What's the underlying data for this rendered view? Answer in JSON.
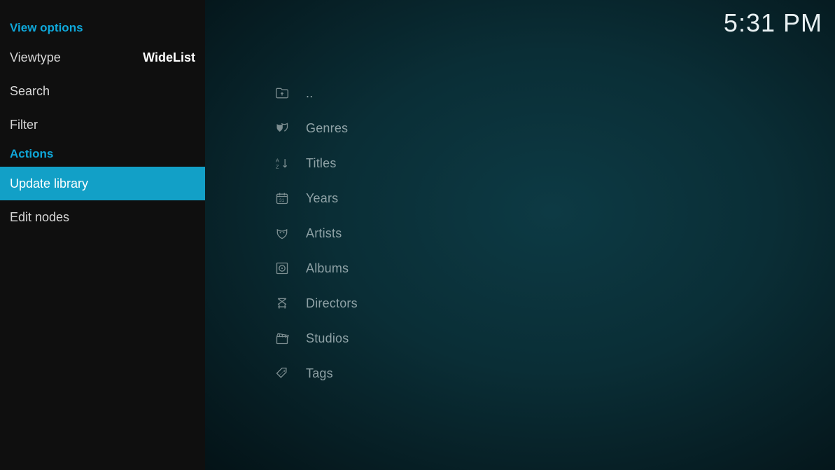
{
  "clock": "5:31 PM",
  "panel": {
    "view_options_heading": "View options",
    "viewtype_label": "Viewtype",
    "viewtype_value": "WideList",
    "search_label": "Search",
    "filter_label": "Filter",
    "actions_heading": "Actions",
    "update_library_label": "Update library",
    "edit_nodes_label": "Edit nodes"
  },
  "content": {
    "up": "..",
    "genres": "Genres",
    "titles": "Titles",
    "years": "Years",
    "artists": "Artists",
    "albums": "Albums",
    "directors": "Directors",
    "studios": "Studios",
    "tags": "Tags"
  }
}
